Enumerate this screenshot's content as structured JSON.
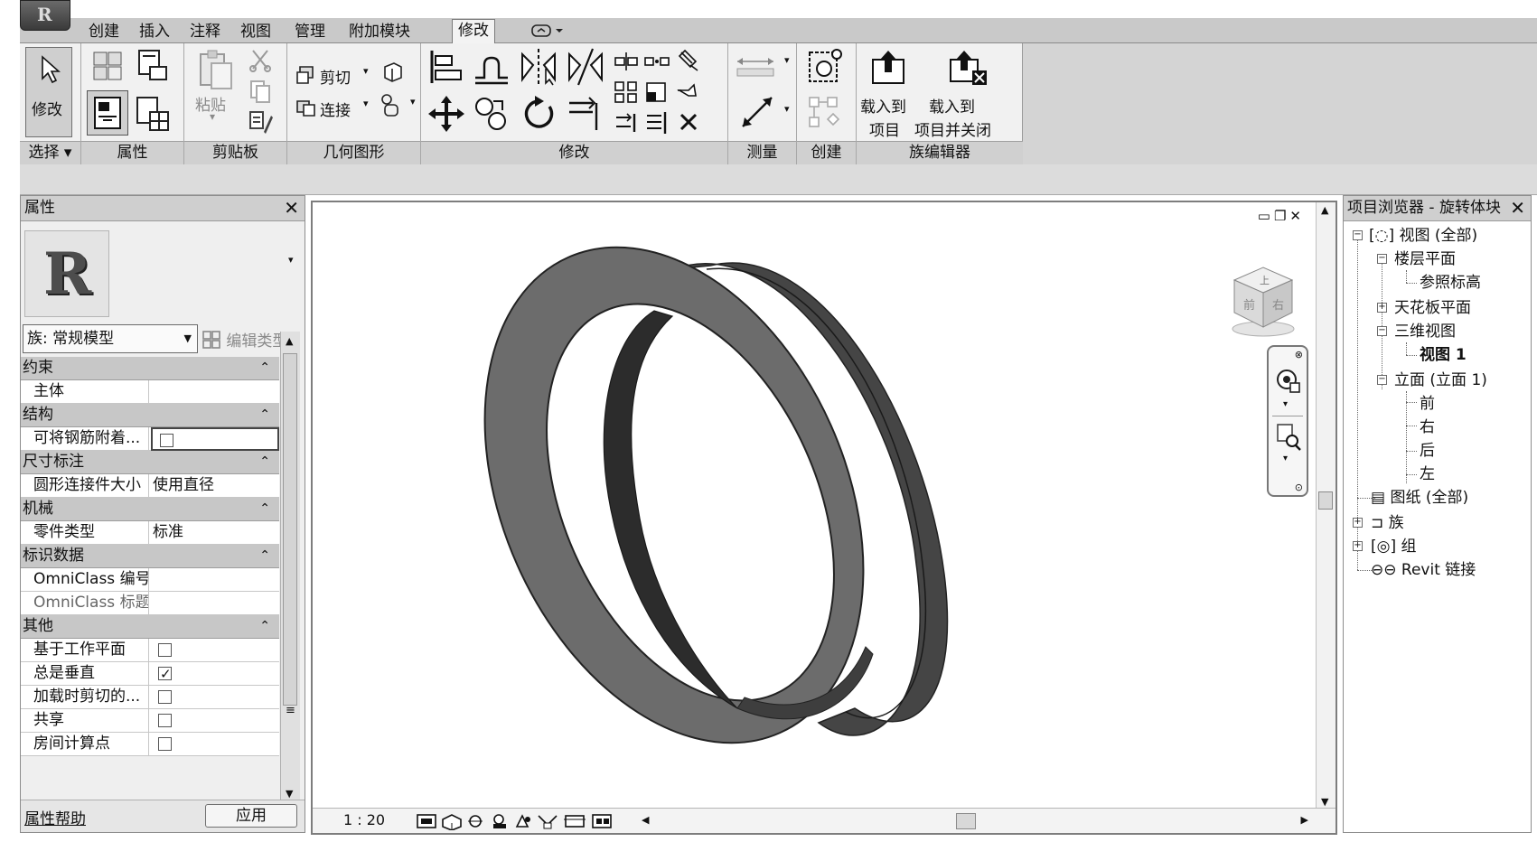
{
  "ribbon": {
    "tabs": [
      "创建",
      "插入",
      "注释",
      "视图",
      "管理",
      "附加模块",
      "修改"
    ],
    "active_tab": "修改",
    "panels": {
      "select": "选择 ▾",
      "properties": "属性",
      "clipboard": "剪贴板",
      "geometry": "几何图形",
      "modify": "修改",
      "measure": "测量",
      "create": "创建",
      "family_editor": "族编辑器"
    },
    "tools": {
      "modify": "修改",
      "paste": "粘贴",
      "cut": "剪切",
      "join": "连接",
      "load_into_project_1": "载入到",
      "load_into_project_2": "项目",
      "load_close_1": "载入到",
      "load_close_2": "项目并关闭"
    }
  },
  "properties": {
    "title": "属性",
    "close": "✕",
    "family_selector": "族: 常规模型",
    "edit_type": "编辑类型",
    "groups": [
      {
        "label": "约束",
        "rows": [
          {
            "key": "主体",
            "value": ""
          }
        ]
      },
      {
        "label": "结构",
        "rows": [
          {
            "key": "可将钢筋附着...",
            "checkbox": false,
            "editing": true
          }
        ]
      },
      {
        "label": "尺寸标注",
        "rows": [
          {
            "key": "圆形连接件大小",
            "value": "使用直径"
          }
        ]
      },
      {
        "label": "机械",
        "rows": [
          {
            "key": "零件类型",
            "value": "标准"
          }
        ]
      },
      {
        "label": "标识数据",
        "rows": [
          {
            "key": "OmniClass 编号",
            "value": ""
          },
          {
            "key": "OmniClass 标题",
            "value": "",
            "dim": true
          }
        ]
      },
      {
        "label": "其他",
        "rows": [
          {
            "key": "基于工作平面",
            "checkbox": false
          },
          {
            "key": "总是垂直",
            "checkbox": true
          },
          {
            "key": "加载时剪切的...",
            "checkbox": false
          },
          {
            "key": "共享",
            "checkbox": false
          },
          {
            "key": "房间计算点",
            "checkbox": false
          }
        ]
      }
    ],
    "help_link": "属性帮助",
    "apply": "应用"
  },
  "view": {
    "scale": "1 : 20",
    "viewcube_top": "上",
    "viewcube_front": "前",
    "viewcube_right": "右"
  },
  "browser": {
    "title": "项目浏览器 - 旋转体块",
    "close": "✕",
    "nodes": [
      {
        "label": "视图 (全部)"
      },
      {
        "label": "楼层平面"
      },
      {
        "label": "参照标高"
      },
      {
        "label": "天花板平面"
      },
      {
        "label": "三维视图"
      },
      {
        "label": "视图 1",
        "bold": true
      },
      {
        "label": "立面 (立面 1)"
      },
      {
        "label": "前"
      },
      {
        "label": "右"
      },
      {
        "label": "后"
      },
      {
        "label": "左"
      },
      {
        "label": "图纸 (全部)"
      },
      {
        "label": "族"
      },
      {
        "label": "组"
      },
      {
        "label": "Revit 链接"
      }
    ]
  },
  "colors": {
    "ring_face": "#6e6e6e",
    "ring_inner": "#3a3a3a",
    "ring_side": "#4a4a4a",
    "ribbon_bg": "#f1f1f1"
  }
}
